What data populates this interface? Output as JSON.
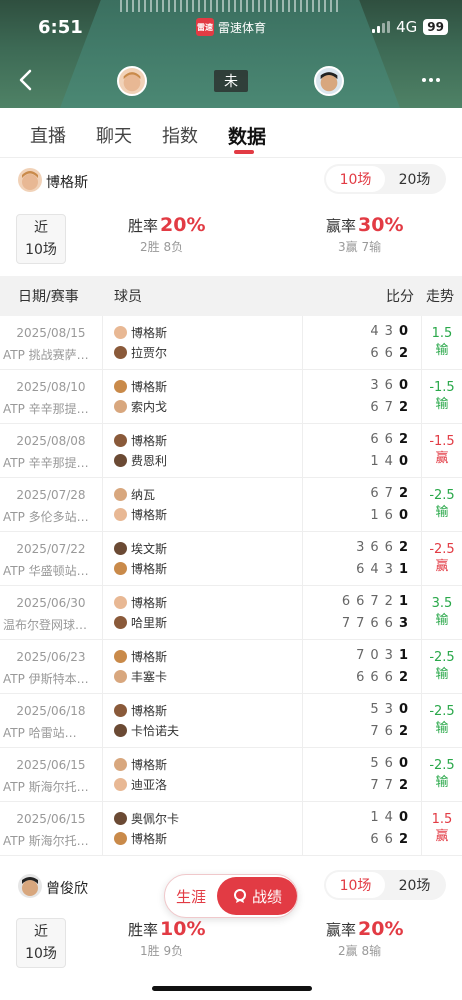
{
  "status": {
    "time": "6:51",
    "brand": "雷速体育",
    "brand_logo": "雷速",
    "network": "4G",
    "battery": "99"
  },
  "match": {
    "state": "未"
  },
  "tabs": [
    "直播",
    "聊天",
    "指数",
    "数据"
  ],
  "colors": {
    "accent": "#e23b44",
    "win": "#e23b44",
    "lose": "#2aa84a"
  },
  "player1": {
    "name": "博格斯",
    "seg": [
      "10场",
      "20场"
    ],
    "recent": [
      "近",
      "10场"
    ],
    "win_rate_label": "胜率",
    "win_rate": "20%",
    "win_sub": "2胜 8负",
    "cover_label": "赢率",
    "cover_rate": "30%",
    "cover_sub": "3赢 7输"
  },
  "table": {
    "headers": {
      "date": "日期/赛事",
      "player": "球员",
      "score": "比分",
      "trend": "走势"
    },
    "rows": [
      {
        "date": "2025/08/15",
        "event": "ATP 挑战赛萨…",
        "p1": "博格斯",
        "p2": "拉贾尔",
        "s1": [
          "4",
          "3",
          "0"
        ],
        "s2": [
          "6",
          "6",
          "2"
        ],
        "line": "1.5",
        "res": "输",
        "type": "lose"
      },
      {
        "date": "2025/08/10",
        "event": "ATP 辛辛那提…",
        "p1": "博格斯",
        "p2": "索内戈",
        "s1": [
          "3",
          "6",
          "0"
        ],
        "s2": [
          "6",
          "7",
          "2"
        ],
        "line": "-1.5",
        "res": "输",
        "type": "lose"
      },
      {
        "date": "2025/08/08",
        "event": "ATP 辛辛那提…",
        "p1": "博格斯",
        "p2": "费恩利",
        "s1": [
          "6",
          "6",
          "2"
        ],
        "s2": [
          "1",
          "4",
          "0"
        ],
        "line": "-1.5",
        "res": "赢",
        "type": "win"
      },
      {
        "date": "2025/07/28",
        "event": "ATP 多伦多站…",
        "p1": "纳瓦",
        "p2": "博格斯",
        "s1": [
          "6",
          "7",
          "2"
        ],
        "s2": [
          "1",
          "6",
          "0"
        ],
        "line": "-2.5",
        "res": "输",
        "type": "lose"
      },
      {
        "date": "2025/07/22",
        "event": "ATP 华盛顿站…",
        "p1": "埃文斯",
        "p2": "博格斯",
        "s1": [
          "3",
          "6",
          "6",
          "2"
        ],
        "s2": [
          "6",
          "4",
          "3",
          "1"
        ],
        "line": "-2.5",
        "res": "赢",
        "type": "win"
      },
      {
        "date": "2025/06/30",
        "event": "温布尔登网球…",
        "p1": "博格斯",
        "p2": "哈里斯",
        "s1": [
          "6",
          "6",
          "7",
          "2",
          "1"
        ],
        "s2": [
          "7",
          "7",
          "6",
          "6",
          "3"
        ],
        "line": "3.5",
        "res": "输",
        "type": "lose"
      },
      {
        "date": "2025/06/23",
        "event": "ATP 伊斯特本…",
        "p1": "博格斯",
        "p2": "丰塞卡",
        "s1": [
          "7",
          "0",
          "3",
          "1"
        ],
        "s2": [
          "6",
          "6",
          "6",
          "2"
        ],
        "line": "-2.5",
        "res": "输",
        "type": "lose"
      },
      {
        "date": "2025/06/18",
        "event": "ATP 哈雷站…",
        "p1": "博格斯",
        "p2": "卡恰诺夫",
        "s1": [
          "5",
          "3",
          "0"
        ],
        "s2": [
          "7",
          "6",
          "2"
        ],
        "line": "-2.5",
        "res": "输",
        "type": "lose"
      },
      {
        "date": "2025/06/15",
        "event": "ATP 斯海尔托…",
        "p1": "博格斯",
        "p2": "迪亚洛",
        "s1": [
          "5",
          "6",
          "0"
        ],
        "s2": [
          "7",
          "7",
          "2"
        ],
        "line": "-2.5",
        "res": "输",
        "type": "lose"
      },
      {
        "date": "2025/06/15",
        "event": "ATP 斯海尔托…",
        "p1": "奥佩尔卡",
        "p2": "博格斯",
        "s1": [
          "1",
          "4",
          "0"
        ],
        "s2": [
          "6",
          "6",
          "2"
        ],
        "line": "1.5",
        "res": "赢",
        "type": "win"
      }
    ]
  },
  "player2": {
    "name": "曾俊欣",
    "seg": [
      "10场",
      "20场"
    ],
    "recent": [
      "近",
      "10场"
    ],
    "win_rate_label": "胜率",
    "win_rate": "10%",
    "win_sub": "1胜 9负",
    "cover_label": "赢率",
    "cover_rate": "20%",
    "cover_sub": "2赢 8输"
  },
  "float_switch": {
    "career": "生涯",
    "record": "战绩"
  }
}
